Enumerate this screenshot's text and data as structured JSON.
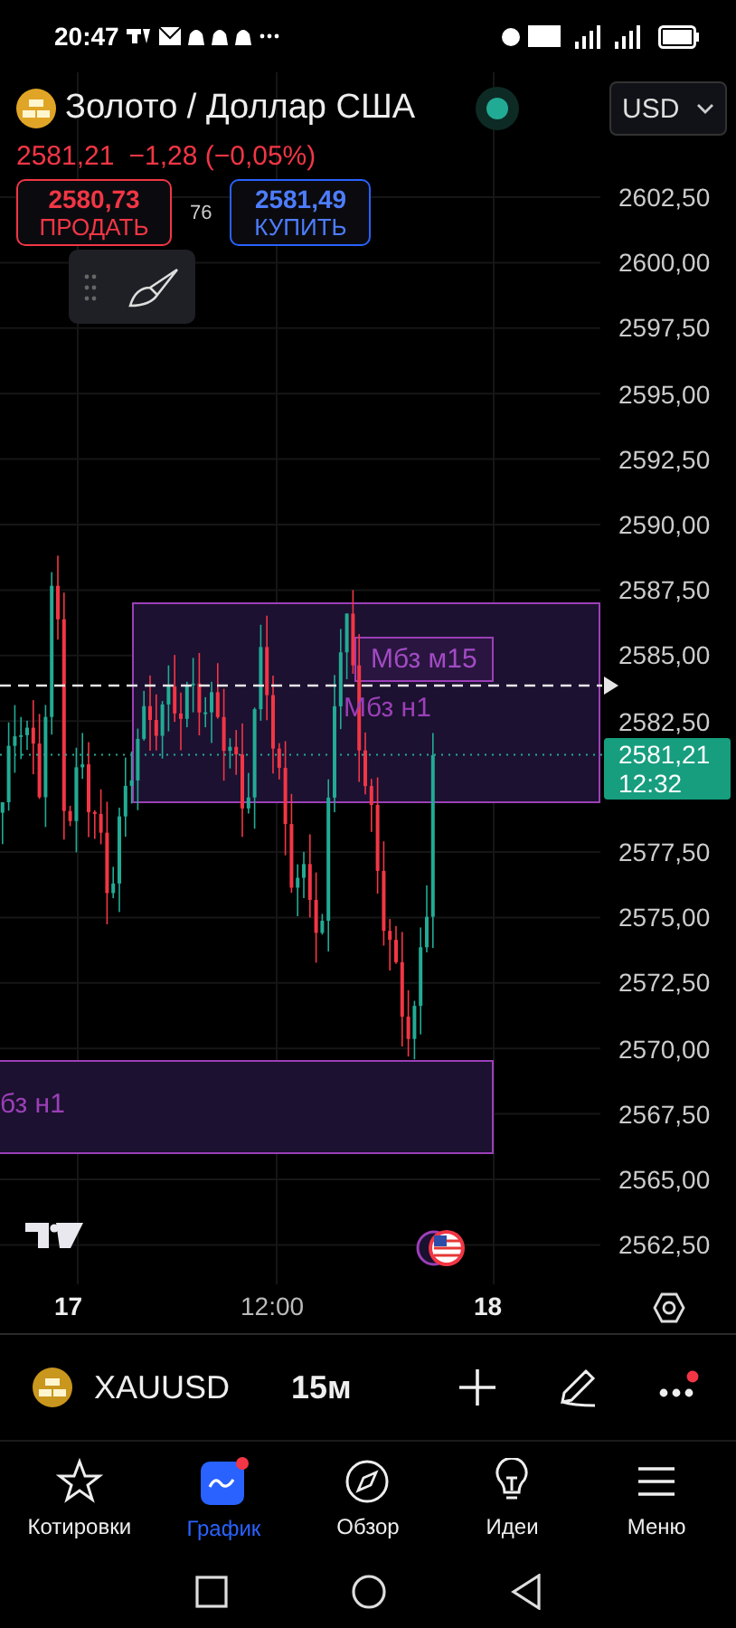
{
  "status_bar": {
    "time": "20:47"
  },
  "header": {
    "title": "Золото / Доллар США",
    "currency": "USD",
    "price": "2581,21",
    "change": "−1,28 (−0,05%)",
    "sell": {
      "price": "2580,73",
      "label": "ПРОДАТЬ"
    },
    "spread": "76",
    "buy": {
      "price": "2581,49",
      "label": "КУПИТЬ"
    }
  },
  "chart": {
    "price_axis": [
      "2602,50",
      "2600,00",
      "2597,50",
      "2595,00",
      "2592,50",
      "2590,00",
      "2587,50",
      "2585,00",
      "2582,50",
      "2577,50",
      "2575,00",
      "2572,50",
      "2570,00",
      "2567,50",
      "2565,00",
      "2562,50"
    ],
    "current_price": {
      "price": "2581,21",
      "countdown": "12:32"
    },
    "time_axis": [
      {
        "label": "17",
        "kind": "day"
      },
      {
        "label": "12:00",
        "kind": "time"
      },
      {
        "label": "18",
        "kind": "day"
      }
    ],
    "zones": [
      {
        "label": "Мбз м15",
        "kind": "boxed"
      },
      {
        "label": "Мбз н1",
        "kind": "plain"
      },
      {
        "label": "бз н1",
        "kind": "plain"
      }
    ]
  },
  "symbol_bar": {
    "symbol": "XAUUSD",
    "interval": "15м"
  },
  "nav": [
    {
      "label": "Котировки",
      "selected": false
    },
    {
      "label": "График",
      "selected": true
    },
    {
      "label": "Обзор",
      "selected": false
    },
    {
      "label": "Идеи",
      "selected": false
    },
    {
      "label": "Меню",
      "selected": false
    }
  ]
}
